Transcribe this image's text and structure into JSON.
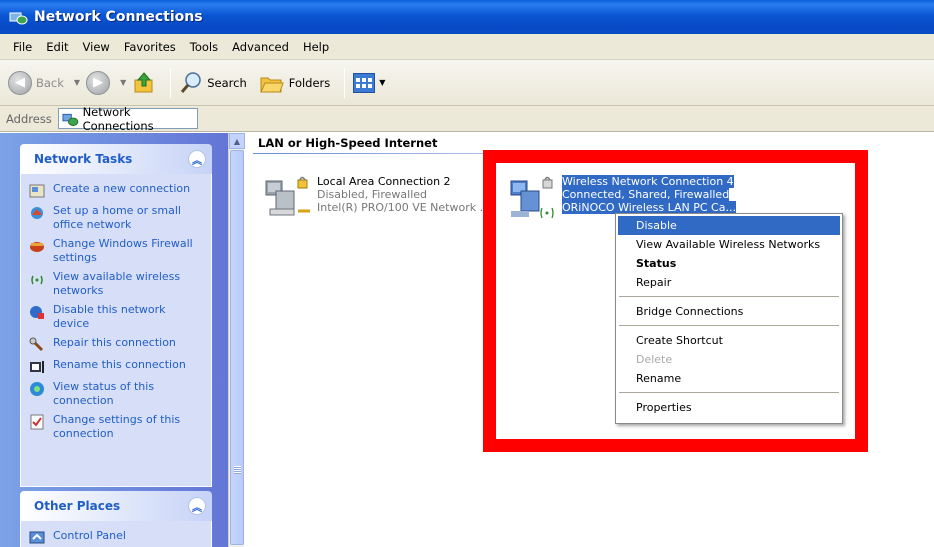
{
  "window": {
    "title": "Network Connections"
  },
  "menubar": [
    "File",
    "Edit",
    "View",
    "Favorites",
    "Tools",
    "Advanced",
    "Help"
  ],
  "toolbar": {
    "back": "Back",
    "search": "Search",
    "folders": "Folders"
  },
  "address": {
    "label": "Address",
    "value": "Network Connections"
  },
  "tasks": {
    "title": "Network Tasks",
    "items": [
      {
        "label": "Create a new connection",
        "icon": "new-connection-icon"
      },
      {
        "label": "Set up a home or small office network",
        "icon": "home-network-icon"
      },
      {
        "label": "Change Windows Firewall settings",
        "icon": "firewall-icon"
      },
      {
        "label": "View available wireless networks",
        "icon": "wireless-icon"
      },
      {
        "label": "Disable this network device",
        "icon": "disable-device-icon"
      },
      {
        "label": "Repair this connection",
        "icon": "repair-icon"
      },
      {
        "label": "Rename this connection",
        "icon": "rename-icon"
      },
      {
        "label": "View status of this connection",
        "icon": "status-icon"
      },
      {
        "label": "Change settings of this connection",
        "icon": "settings-icon"
      }
    ]
  },
  "other_places": {
    "title": "Other Places",
    "items": [
      {
        "label": "Control Panel",
        "icon": "control-panel-icon"
      }
    ]
  },
  "group": {
    "header": "LAN or High-Speed Internet"
  },
  "connections": [
    {
      "name": "Local Area Connection 2",
      "status": "Disabled, Firewalled",
      "device": "Intel(R) PRO/100 VE Network ..."
    },
    {
      "name": "Wireless Network Connection 4",
      "status": "Connected, Shared, Firewalled",
      "device": "ORiNOCO Wireless LAN PC Ca..."
    }
  ],
  "context_menu": {
    "items": [
      {
        "label": "Disable",
        "state": "highlighted"
      },
      {
        "label": "View Available Wireless Networks",
        "state": "normal"
      },
      {
        "label": "Status",
        "state": "bold"
      },
      {
        "label": "Repair",
        "state": "normal"
      },
      {
        "label": "Bridge Connections",
        "state": "normal"
      },
      {
        "label": "Create Shortcut",
        "state": "normal"
      },
      {
        "label": "Delete",
        "state": "disabled"
      },
      {
        "label": "Rename",
        "state": "normal"
      },
      {
        "label": "Properties",
        "state": "normal"
      }
    ]
  },
  "colors": {
    "title_bar": "#0a56d4",
    "highlight_frame": "#ff0000",
    "selection": "#316ac5",
    "task_link": "#215dc6"
  }
}
